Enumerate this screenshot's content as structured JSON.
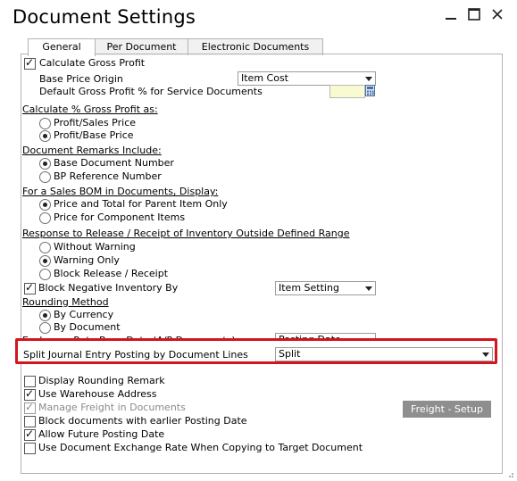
{
  "window": {
    "title": "Document Settings",
    "accent_color": "#d3151e"
  },
  "tabs": [
    {
      "label": "General",
      "active": true
    },
    {
      "label": "Per Document",
      "active": false
    },
    {
      "label": "Electronic Documents",
      "active": false
    }
  ],
  "gross_profit": {
    "calculate_label": "Calculate Gross Profit",
    "calculate_checked": true,
    "base_price_origin_label": "Base Price Origin",
    "base_price_origin_value": "Item Cost",
    "default_gp_label": "Default Gross Profit % for Service Documents",
    "default_gp_value": ""
  },
  "calc_gp_as": {
    "header": "Calculate % Gross Profit as:",
    "options": [
      "Profit/Sales Price",
      "Profit/Base Price"
    ],
    "selected": 1
  },
  "doc_remarks": {
    "header": "Document Remarks Include:",
    "options": [
      "Base Document Number",
      "BP Reference Number"
    ],
    "selected": 0
  },
  "sales_bom": {
    "header": "For a Sales BOM in Documents, Display:",
    "options": [
      "Price and Total for Parent Item Only",
      "Price for Component Items"
    ],
    "selected": 0
  },
  "response_release": {
    "header": "Response to Release / Receipt of Inventory Outside Defined Range",
    "options": [
      "Without Warning",
      "Warning Only",
      "Block Release / Receipt"
    ],
    "selected": 1
  },
  "block_negative": {
    "label": "Block Negative Inventory By",
    "checked": true,
    "value": "Item Setting"
  },
  "rounding": {
    "header": "Rounding Method",
    "options": [
      "By Currency",
      "By Document"
    ],
    "selected": 0
  },
  "exchange_rate": {
    "label": "Exchange Rate Base Date (A/P Documents)",
    "value": "Posting Date"
  },
  "split_journal": {
    "label": "Split Journal Entry Posting by Document Lines",
    "value": "Split"
  },
  "bottom_options": [
    {
      "label": "Display Rounding Remark",
      "checked": false,
      "disabled": false
    },
    {
      "label": "Use Warehouse Address",
      "checked": true,
      "disabled": false
    },
    {
      "label": "Manage Freight in Documents",
      "checked": true,
      "disabled": true
    },
    {
      "label": "Block documents with earlier Posting Date",
      "checked": false,
      "disabled": false
    },
    {
      "label": "Allow Future Posting Date",
      "checked": true,
      "disabled": false
    },
    {
      "label": "Use Document Exchange Rate When Copying to Target Document",
      "checked": false,
      "disabled": false
    }
  ],
  "freight_button": "Freight - Setup"
}
